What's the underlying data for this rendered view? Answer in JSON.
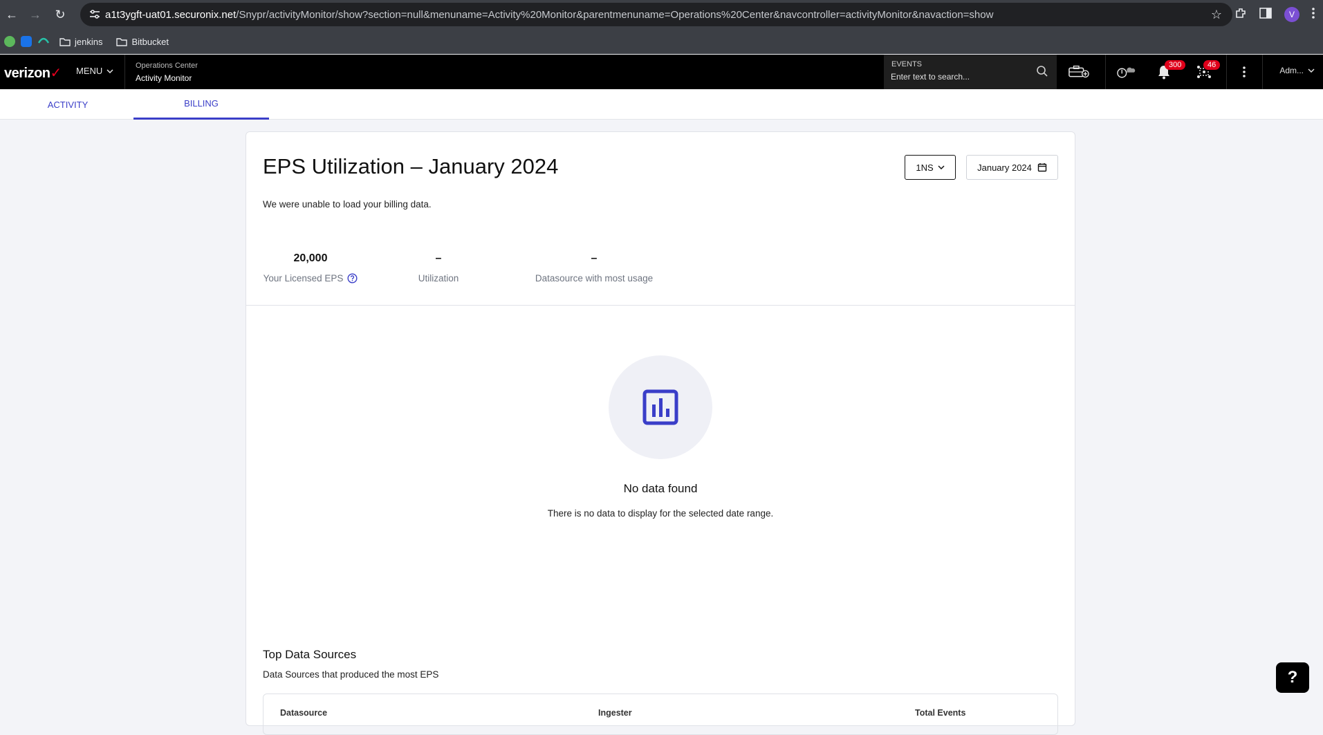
{
  "browser": {
    "url_host": "a1t3ygft-uat01.securonix.net",
    "url_path": "/Snypr/activityMonitor/show?section=null&menuname=Activity%20Monitor&parentmenuname=Operations%20Center&navcontroller=activityMonitor&navaction=show",
    "profile_initial": "V",
    "bookmarks": [
      "jenkins",
      "Bitbucket"
    ]
  },
  "header": {
    "logo": "verizon",
    "menu_label": "MENU",
    "breadcrumb_parent": "Operations Center",
    "breadcrumb_current": "Activity Monitor",
    "search_label": "EVENTS",
    "search_placeholder": "Enter text to search...",
    "notifications_count": "300",
    "alerts_count": "46",
    "user_label": "Adm..."
  },
  "tabs": [
    {
      "label": "ACTIVITY",
      "active": false
    },
    {
      "label": "BILLING",
      "active": true
    }
  ],
  "billing": {
    "title": "EPS Utilization – January 2024",
    "tenant_select": "1NS",
    "month_select": "January 2024",
    "error_message": "We were unable to load your billing data.",
    "stats": [
      {
        "value": "20,000",
        "label": "Your Licensed EPS"
      },
      {
        "value": "–",
        "label": "Utilization"
      },
      {
        "value": "–",
        "label": "Datasource with most usage"
      }
    ],
    "empty_title": "No data found",
    "empty_subtitle": "There is no data to display for the selected date range.",
    "top_sources_title": "Top Data Sources",
    "top_sources_subtitle": "Data Sources that produced the most EPS",
    "table_headers": [
      "Datasource",
      "Ingester",
      "Total Events"
    ]
  },
  "help_label": "?",
  "colors": {
    "accent": "#3a3ec8",
    "badge": "#e0001a",
    "header_bg": "#000000"
  }
}
